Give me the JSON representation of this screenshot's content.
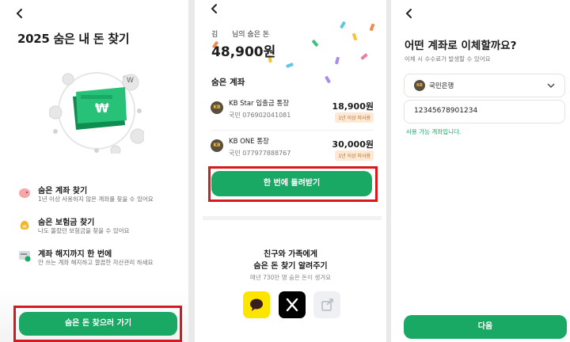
{
  "screen1": {
    "back_icon": "chevron-left-icon",
    "title": "2025 숨은 내 돈 찾기",
    "coin_mark": "W",
    "card_mark": "₩",
    "features": [
      {
        "icon": "piggy-bank-icon",
        "title": "숨은 계좌 찾기",
        "desc": "1년 이상 사용하지 않은 계좌를 찾을 수 있어요"
      },
      {
        "icon": "money-bag-icon",
        "title": "숨은 보험금 찾기",
        "desc": "나도 몰랐던 보험금을 찾을 수 있어요"
      },
      {
        "icon": "card-list-icon",
        "title": "계좌 해지까지 한 번에",
        "desc": "안 쓰는 계좌 해지하고 깔끔한 자산관리 하세요"
      }
    ],
    "cta_label": "숨은 돈 찾으러 가기"
  },
  "screen2": {
    "back_icon": "chevron-left-icon",
    "owner_prefix": "김",
    "owner_suffix": "님의 숨은 돈",
    "total": "48,900원",
    "section_title": "숨은 계좌",
    "accounts": [
      {
        "bank_logo": "KB",
        "name": "KB Star 입출금 통장",
        "number": "국민 076902041081",
        "amount": "18,900원",
        "badge": "1년 이상 미사용"
      },
      {
        "bank_logo": "KB",
        "name": "KB ONE 통장",
        "number": "국민 077977888767",
        "amount": "30,000원",
        "badge": "1년 이상 미사용"
      }
    ],
    "cta_label": "한 번에 돌려받기",
    "share_title_line1": "친구와 가족에게",
    "share_title_line2": "숨은 돈 찾기 알려주기",
    "share_sub": "매년 730만 명 숨은 돈이 생겨요",
    "share_buttons": [
      {
        "name": "kakaotalk-share-button",
        "icon": "speech-bubble-icon",
        "bg": "#fee500"
      },
      {
        "name": "x-share-button",
        "icon": "x-logo-icon",
        "bg": "#000000"
      },
      {
        "name": "link-share-button",
        "icon": "share-link-icon",
        "bg": "#eef0f3"
      }
    ],
    "accent": "#1aa865"
  },
  "screen3": {
    "back_icon": "chevron-left-icon",
    "title": "어떤 계좌로 이체할까요?",
    "subtitle": "이체 시 수수료가 발생할 수 있어요",
    "bank_logo": "KB",
    "bank_value": "국민은행",
    "account_value": "12345678901234",
    "helper": "사용 가능 계좌입니다.",
    "next_label": "다음"
  }
}
